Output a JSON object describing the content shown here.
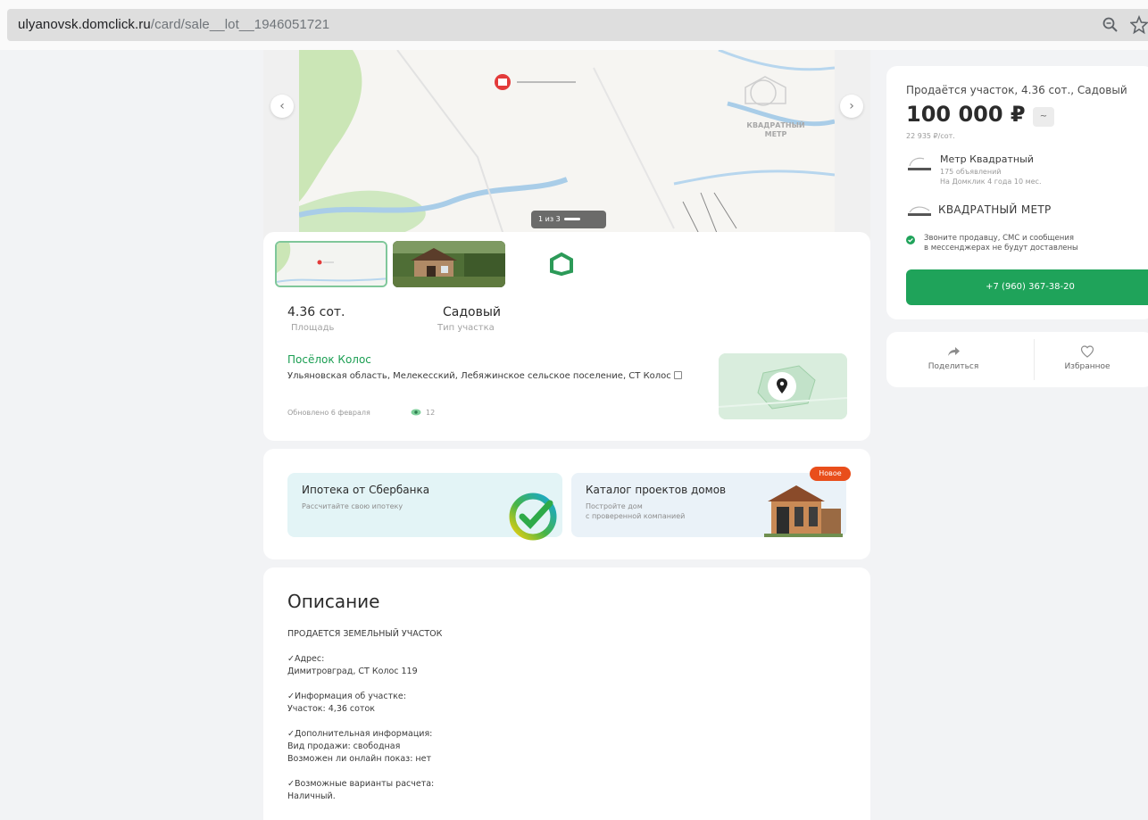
{
  "browser": {
    "url_host": "ulyanovsk.domclick.ru",
    "url_path": "/card/sale__lot__1946051721"
  },
  "gallery": {
    "counter": "1 из 3",
    "map_label": "КВАДРАТНЫЙ МЕТР"
  },
  "facts": [
    {
      "value": "4.36 сот.",
      "label": "Площадь"
    },
    {
      "value": "Садовый",
      "label": "Тип участка"
    }
  ],
  "location": {
    "village": "Посёлок Колос",
    "address": "Ульяновская область, Мелекесский, Лебяжинское сельское поселение, СТ Колос",
    "updated": "Обновлено 6 февраля",
    "views": "12"
  },
  "promos": {
    "mortgage": {
      "title": "Ипотека от Сбербанка",
      "subtitle": "Рассчитайте свою ипотеку"
    },
    "catalog": {
      "title": "Каталог проектов домов",
      "subtitle_1": "Постройте дом",
      "subtitle_2": "с проверенной компанией",
      "badge": "Новое"
    }
  },
  "description": {
    "title": "Описание",
    "lines": [
      "ПРОДАЕТСЯ ЗЕМЕЛЬНЫЙ УЧАСТОК",
      "",
      "✓Адрес:",
      "Димитровград, СТ Колос 119",
      "",
      "✓Информация об участке:",
      "Участок: 4,36 соток",
      "",
      "✓Дополнительная информация:",
      "Вид продажи: свободная",
      "Возможен ли онлайн показ: нет",
      "",
      "✓Возможные варианты расчета:",
      "Наличный."
    ]
  },
  "offer": {
    "title": "Продаётся участок, 4.36 сот., Садовый",
    "price": "100 000 ₽",
    "price_per_unit": "22 935 ₽/сот.",
    "agent_name": "Метр Квадратный",
    "agent_listings": "175 объявлений",
    "agent_tenure": "На Домклик 4 года 10 мес.",
    "agency_name": "КВАДРАТНЫЙ МЕТР",
    "notice_1": "Звоните продавцу, СМС и сообщения",
    "notice_2": "в мессенджерах не будут доставлены",
    "phone": "+7 (960) 367-38-20"
  },
  "actions": {
    "share": "Поделиться",
    "favorite": "Избранное"
  },
  "colors": {
    "brand_green": "#1fa35a",
    "link_green": "#1a9e52",
    "badge_orange": "#e94e1b"
  }
}
